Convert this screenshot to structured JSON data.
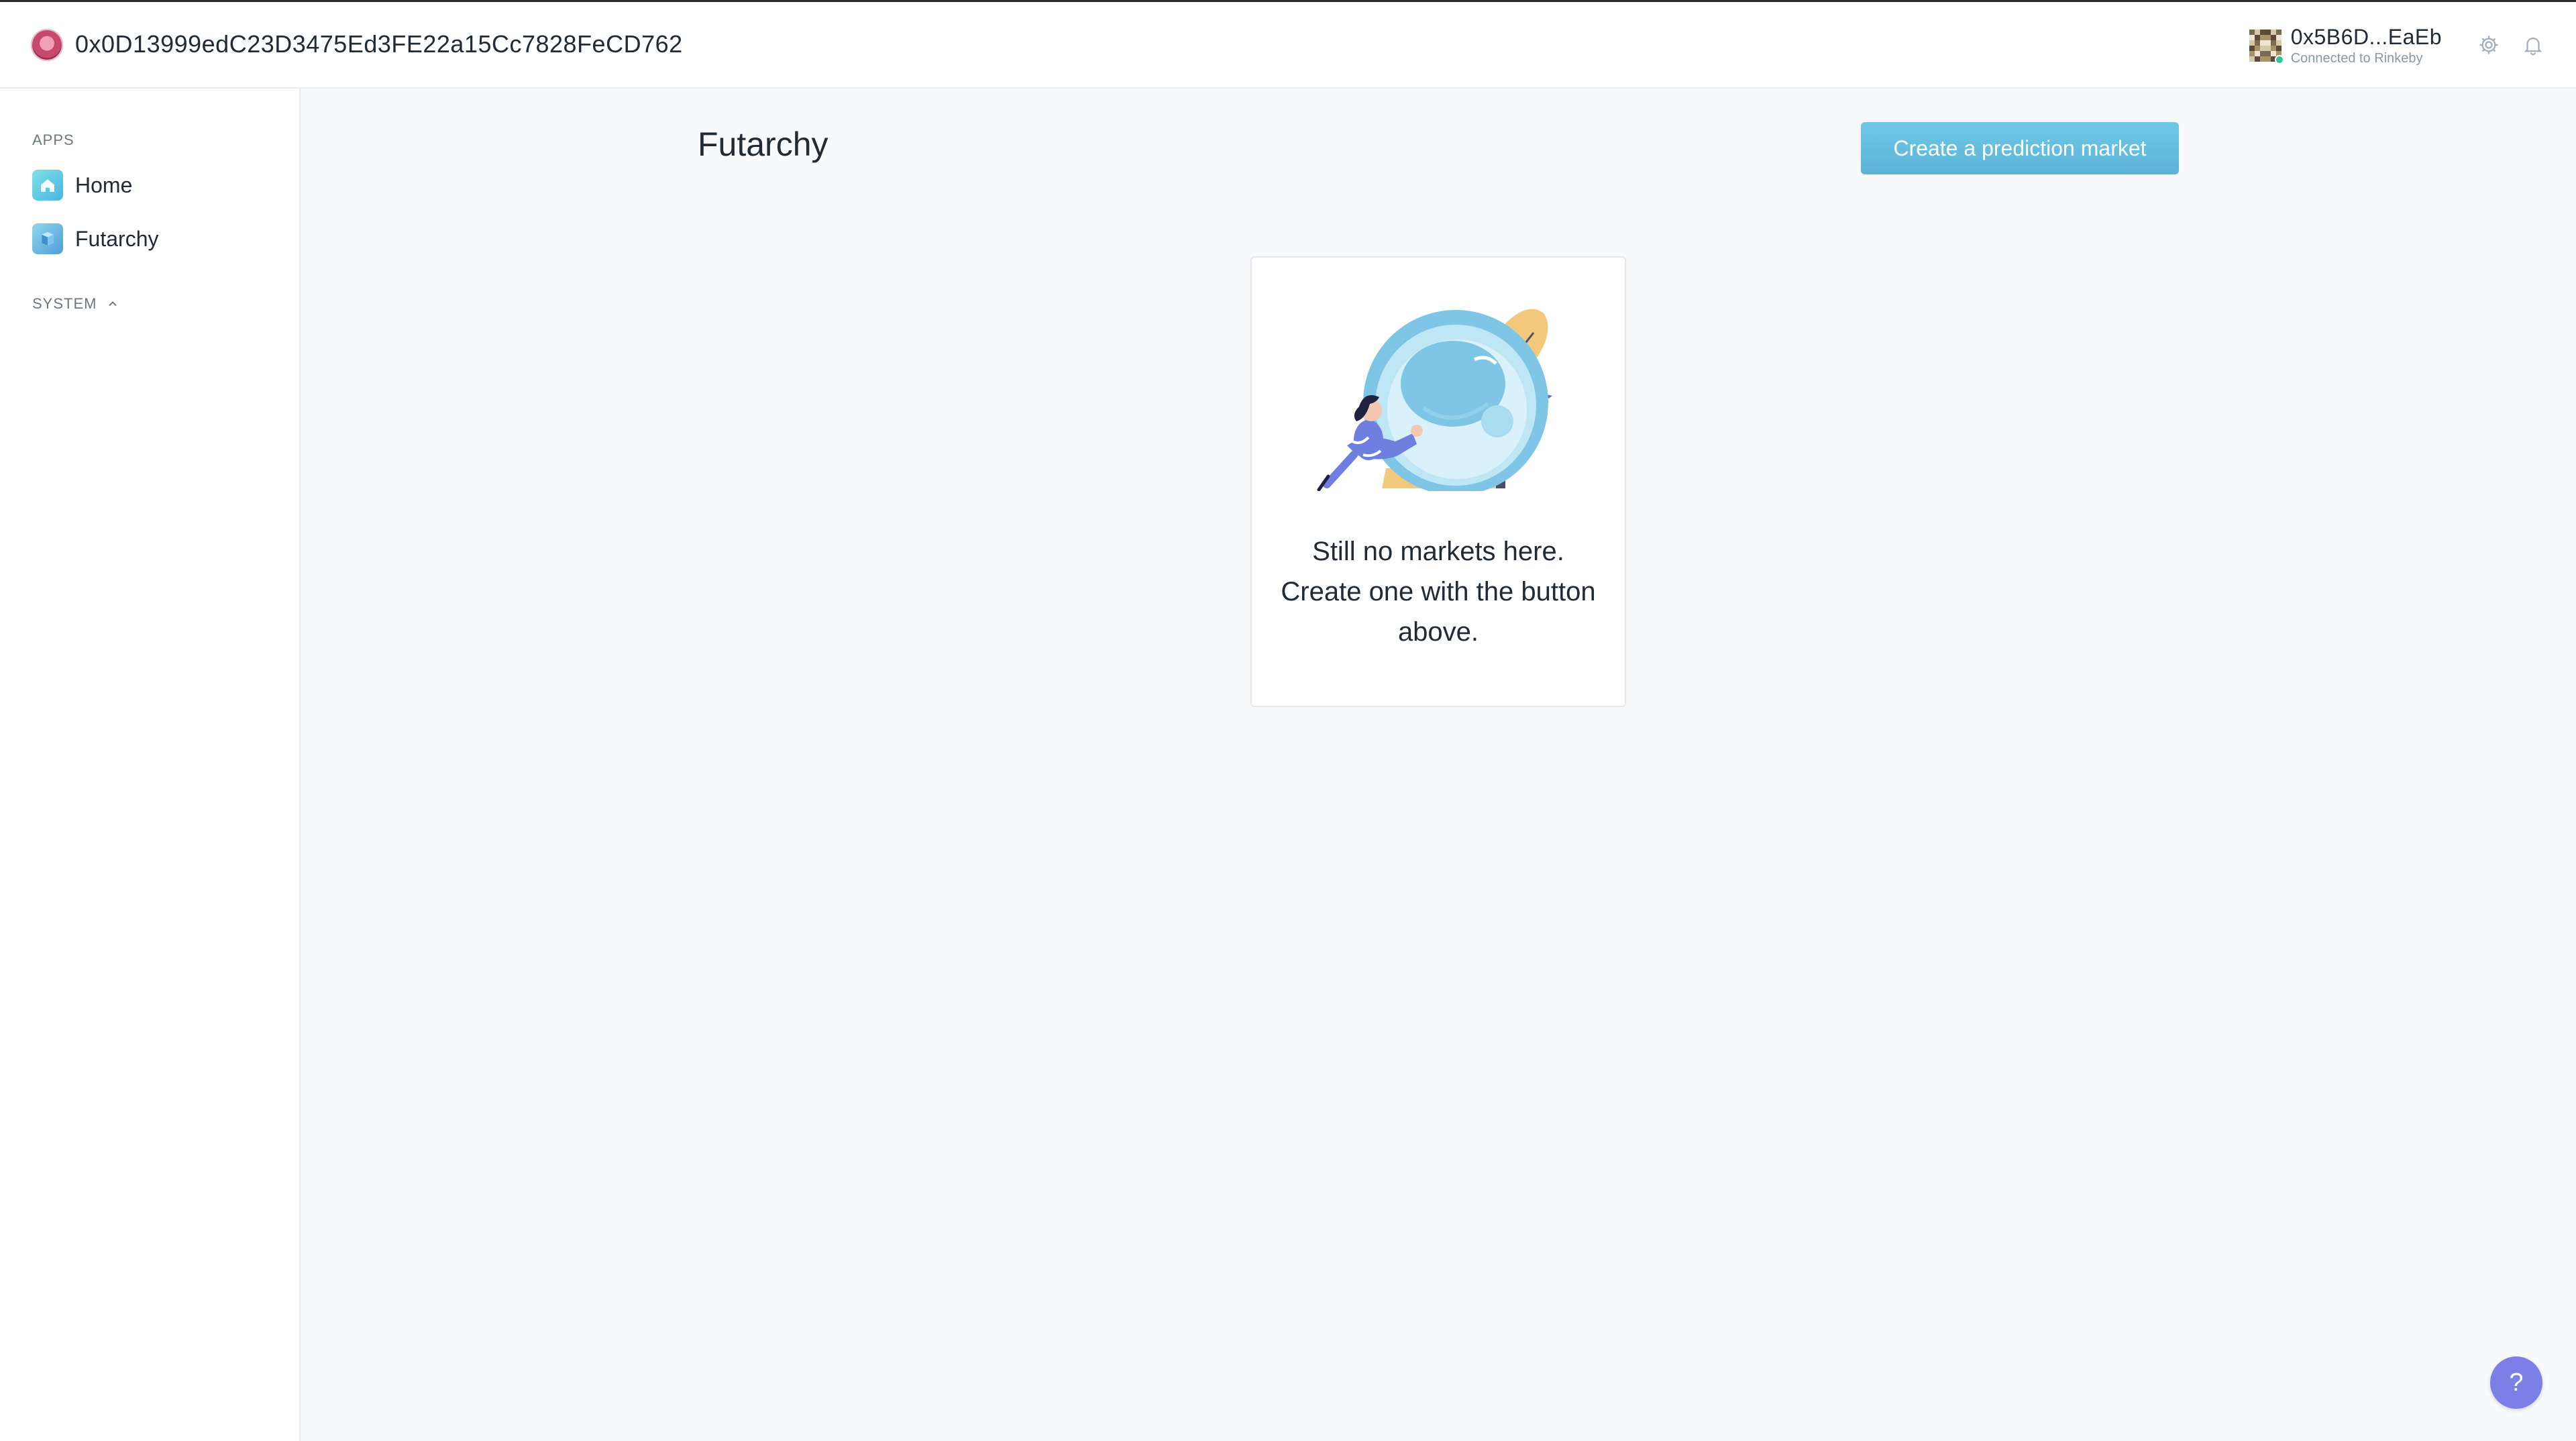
{
  "header": {
    "org_address": "0x0D13999edC23D3475Ed3FE22a15Cc7828FeCD762",
    "account_address": "0x5B6D...EaEb",
    "network_status": "Connected to Rinkeby",
    "icons": [
      "settings-icon",
      "bell-icon"
    ]
  },
  "sidebar": {
    "apps_label": "APPS",
    "items": [
      {
        "label": "Home",
        "icon": "home-icon"
      },
      {
        "label": "Futarchy",
        "icon": "futarchy-icon"
      }
    ],
    "system_label": "SYSTEM"
  },
  "main": {
    "title": "Futarchy",
    "create_button_label": "Create a prediction market",
    "empty_state": {
      "illustration": "crystal-ball-illustration",
      "message": "Still no markets here. Create one with the button above."
    }
  },
  "help_button_label": "?",
  "colors": {
    "accent": "#6fc8e6",
    "help": "#7b7fe6",
    "online": "#2cc68f"
  }
}
